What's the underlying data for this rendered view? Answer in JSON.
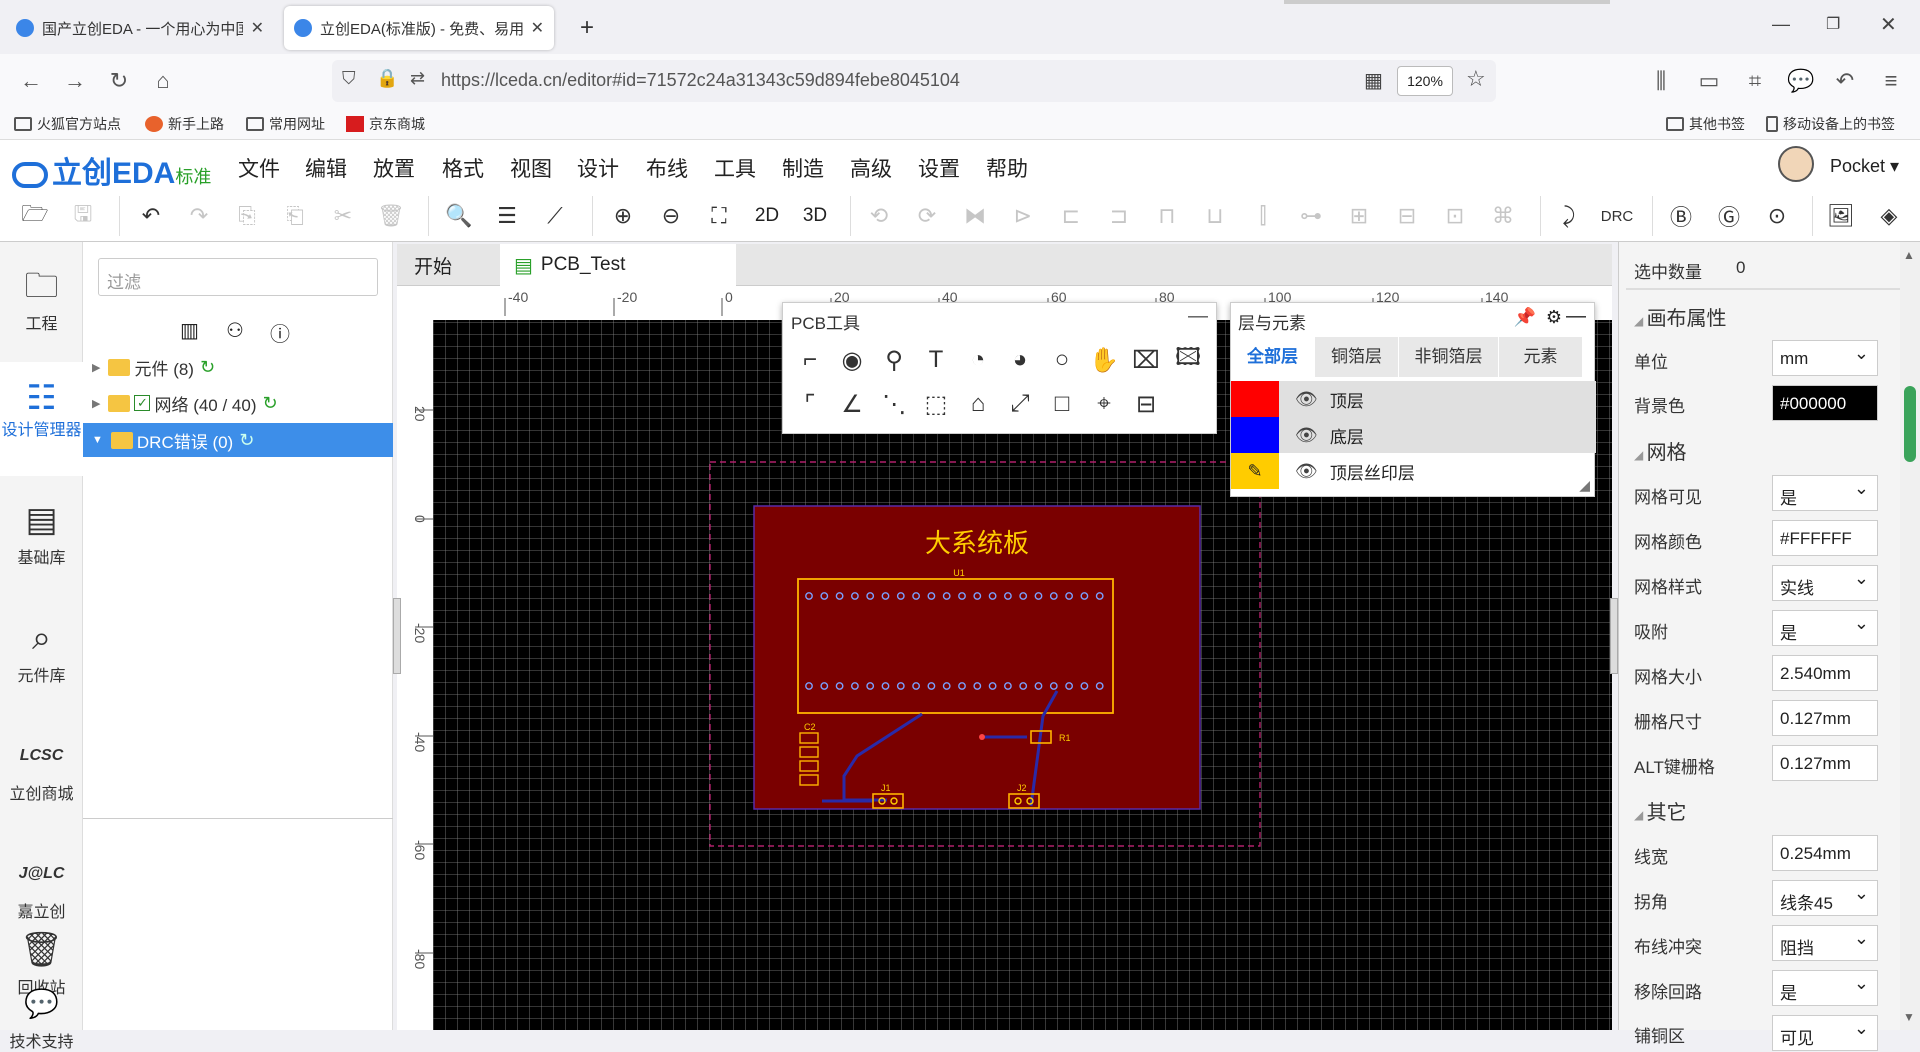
{
  "browser": {
    "tabs": [
      {
        "title": "国产立创EDA - 一个用心为中国"
      },
      {
        "title": "立创EDA(标准版) - 免费、易用"
      }
    ],
    "url": "https://lceda.cn/editor#id=71572c24a31343c59d894febe8045104",
    "zoom": "120%",
    "bookmarks": [
      {
        "label": "火狐官方站点"
      },
      {
        "label": "新手上路"
      },
      {
        "label": "常用网址"
      },
      {
        "label": "京东商城"
      },
      {
        "label": "其他书签"
      },
      {
        "label": "移动设备上的书签"
      }
    ]
  },
  "app": {
    "logo": "立创EDA",
    "edition": "标准",
    "menu": [
      "文件",
      "编辑",
      "放置",
      "格式",
      "视图",
      "设计",
      "布线",
      "工具",
      "制造",
      "高级",
      "设置",
      "帮助"
    ],
    "user": "Pocket",
    "toolbar_text": {
      "2d": "2D",
      "3d": "3D",
      "drc": "DRC"
    }
  },
  "leftbar": [
    {
      "label": "工程"
    },
    {
      "label": "设计管理器"
    },
    {
      "label": "基础库"
    },
    {
      "label": "元件库"
    },
    {
      "label": "立创商城"
    },
    {
      "label": "嘉立创"
    },
    {
      "label": "回收站"
    },
    {
      "label": "技术支持"
    }
  ],
  "tree": {
    "filter_placeholder": "过滤",
    "items": [
      {
        "label": "元件 (8)"
      },
      {
        "label": "网络 (40 / 40)"
      },
      {
        "label": "DRC错误 (0)"
      }
    ]
  },
  "doc_tabs": [
    {
      "label": "开始"
    },
    {
      "label": "PCB_Test"
    }
  ],
  "ruler_x": [
    "-40",
    "-20",
    "0",
    "20",
    "40",
    "60",
    "80",
    "100",
    "120",
    "140"
  ],
  "ruler_y": [
    "20",
    "0",
    "-20",
    "-40",
    "-60",
    "-80"
  ],
  "pcb": {
    "board_title": "大系统板",
    "u1": "U1",
    "r1": "R1",
    "j1": "J1",
    "j2": "J2",
    "c2": "C2",
    "colors": {
      "background": "#000000",
      "board": "#7a0000",
      "outline": "#ffb300",
      "track": "#2a2aa8",
      "silk": "#ffcc00"
    }
  },
  "pcb_tools": {
    "title": "PCB工具"
  },
  "layers": {
    "title": "层与元素",
    "tabs": [
      "全部层",
      "铜箔层",
      "非铜箔层",
      "元素"
    ],
    "rows": [
      {
        "label": "顶层",
        "color": "#ff0000"
      },
      {
        "label": "底层",
        "color": "#0000ff"
      },
      {
        "label": "顶层丝印层",
        "color": "#ffcc00"
      }
    ]
  },
  "props": {
    "selected_label": "选中数量",
    "selected_value": "0",
    "section_canvas": "画布属性",
    "unit_label": "单位",
    "unit_value": "mm",
    "bg_label": "背景色",
    "bg_value": "#000000",
    "section_grid": "网格",
    "grid_visible_label": "网格可见",
    "grid_visible_value": "是",
    "grid_color_label": "网格颜色",
    "grid_color_value": "#FFFFFF",
    "grid_style_label": "网格样式",
    "grid_style_value": "实线",
    "snap_label": "吸附",
    "snap_value": "是",
    "grid_size_label": "网格大小",
    "grid_size_value": "2.540mm",
    "fence_label": "栅格尺寸",
    "fence_value": "0.127mm",
    "alt_label": "ALT键栅格",
    "alt_value": "0.127mm",
    "section_other": "其它",
    "width_label": "线宽",
    "width_value": "0.254mm",
    "corner_label": "拐角",
    "corner_value": "线条45",
    "conflict_label": "布线冲突",
    "conflict_value": "阻挡",
    "loop_label": "移除回路",
    "loop_value": "是",
    "last_label": "铺铜区",
    "last_value": "可见"
  }
}
